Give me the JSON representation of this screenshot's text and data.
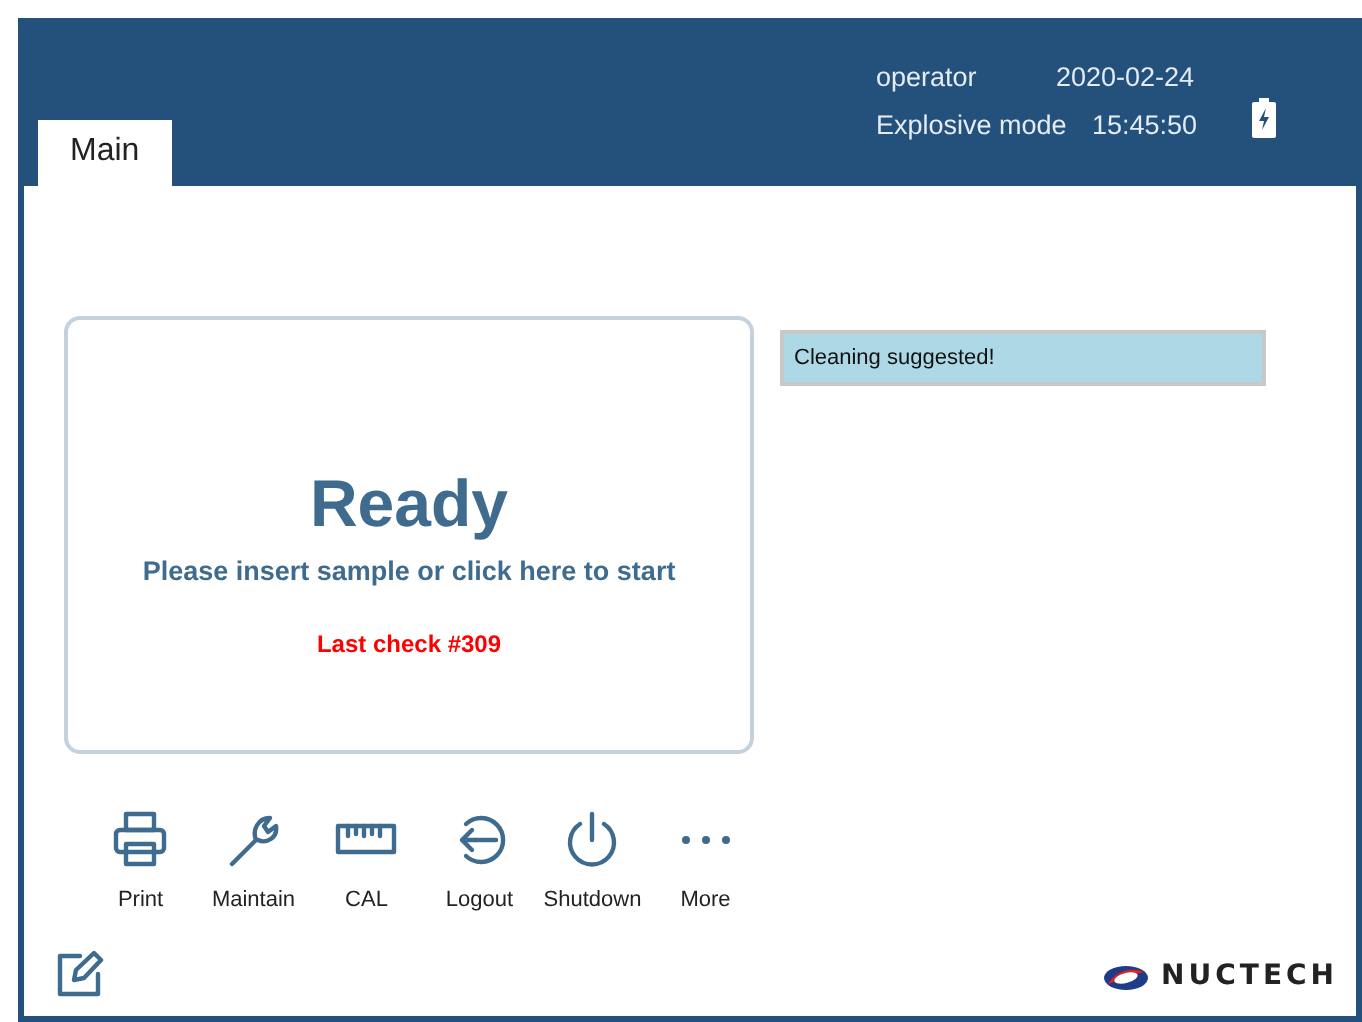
{
  "header": {
    "user": "operator",
    "date": "2020-02-24",
    "mode": "Explosive mode",
    "time": "15:45:50"
  },
  "tabs": [
    {
      "label": "Main",
      "selected": true
    }
  ],
  "status_panel": {
    "title": "Ready",
    "instruction": "Please insert sample or click here to start",
    "last_check": "Last check #309"
  },
  "notice": "Cleaning suggested!",
  "toolbar": [
    {
      "label": "Print",
      "kind": "print"
    },
    {
      "label": "Maintain",
      "kind": "wrench"
    },
    {
      "label": "CAL",
      "kind": "ruler"
    },
    {
      "label": "Logout",
      "kind": "logout"
    },
    {
      "label": "Shutdown",
      "kind": "power"
    },
    {
      "label": "More",
      "kind": "more"
    }
  ],
  "logo": "NUCTECH"
}
